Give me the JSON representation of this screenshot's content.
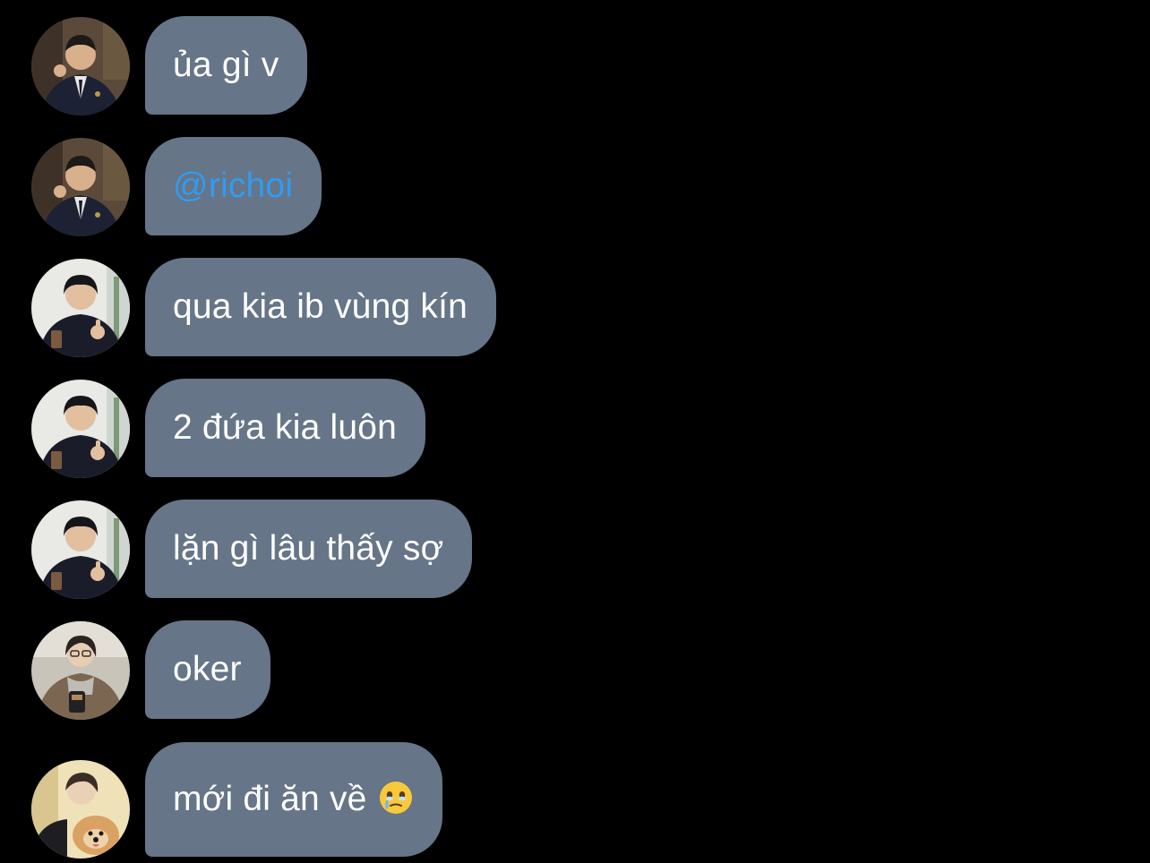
{
  "chat": {
    "messages": [
      {
        "text": "ủa gì v",
        "avatar": "man-in-blazer-avatar",
        "mention": false
      },
      {
        "text": "@richoi",
        "avatar": "man-in-blazer-avatar",
        "mention": true
      },
      {
        "text": "qua kia ib vùng kín",
        "avatar": "man-thumbs-up-avatar",
        "mention": false
      },
      {
        "text": "2 đứa kia luôn",
        "avatar": "man-thumbs-up-avatar",
        "mention": false
      },
      {
        "text": "lặn gì lâu thấy sợ",
        "avatar": "man-thumbs-up-avatar",
        "mention": false
      },
      {
        "text": "oker",
        "avatar": "person-with-glasses-avatar",
        "mention": false
      },
      {
        "text": "mới đi ăn về",
        "avatar": "person-with-dog-avatar",
        "mention": false,
        "emoji": "face-holding-back-tears-emoji"
      }
    ]
  },
  "colors": {
    "background": "#000000",
    "bubble": "#667587",
    "text": "#ffffff",
    "mention": "#2f9cf2"
  }
}
